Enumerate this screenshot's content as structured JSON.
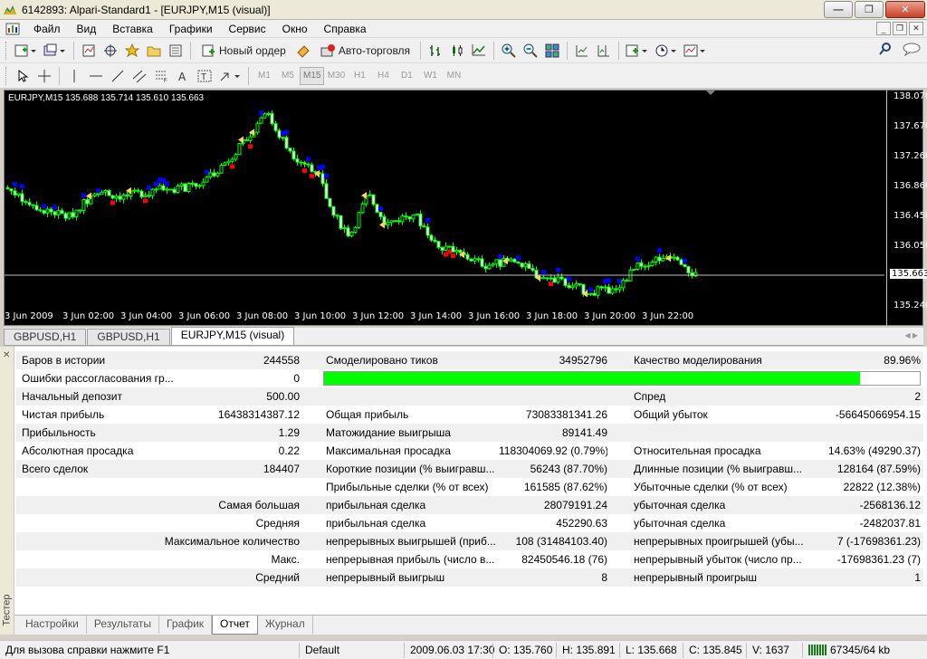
{
  "window": {
    "title": "6142893: Alpari-Standard1 - [EURJPY,M15 (visual)]"
  },
  "menu": {
    "items": [
      "Файл",
      "Вид",
      "Вставка",
      "Графики",
      "Сервис",
      "Окно",
      "Справка"
    ]
  },
  "toolbar": {
    "new_order_label": "Новый ордер",
    "auto_trade_label": "Авто-торговля",
    "timeframes": [
      "M1",
      "M5",
      "M15",
      "M30",
      "H1",
      "H4",
      "D1",
      "W1",
      "MN"
    ],
    "active_timeframe": "M15"
  },
  "chart": {
    "info": "EURJPY,M15  135.688 135.714 135.610 135.663",
    "price_labels": [
      "138.070",
      "137.670",
      "137.260",
      "136.860",
      "136.450",
      "136.050",
      "135.663",
      "135.240"
    ],
    "current_price": "135.663",
    "time_labels": [
      "3 Jun 2009",
      "3 Jun 02:00",
      "3 Jun 04:00",
      "3 Jun 06:00",
      "3 Jun 08:00",
      "3 Jun 10:00",
      "3 Jun 12:00",
      "3 Jun 14:00",
      "3 Jun 16:00",
      "3 Jun 18:00",
      "3 Jun 20:00",
      "3 Jun 22:00"
    ],
    "colors": {
      "background": "#000000",
      "bull": "#00ff00",
      "bear": "#ffffff",
      "buy_marker": "#0000ff",
      "sell_marker": "#ff0000",
      "arrow": "#ffd060"
    }
  },
  "chart_tabs": {
    "items": [
      "GBPUSD,H1",
      "GBPUSD,H1",
      "EURJPY,M15 (visual)"
    ],
    "active": 2
  },
  "report": {
    "r1": {
      "l1": "Баров в истории",
      "v1": "244558",
      "l2": "Смоделировано тиков",
      "v2": "34952796",
      "l3": "Качество моделирования",
      "v3": "89.96%"
    },
    "r2": {
      "l1": "Ошибки рассогласования гр...",
      "v1": "0",
      "progress": 89.96
    },
    "r3": {
      "l1": "Начальный депозит",
      "v1": "500.00",
      "l3": "Спред",
      "v3": "2"
    },
    "r4": {
      "l1": "Чистая прибыль",
      "v1": "16438314387.12",
      "l2": "Общая прибыль",
      "v2": "73083381341.26",
      "l3": "Общий убыток",
      "v3": "-56645066954.15"
    },
    "r5": {
      "l1": "Прибыльность",
      "v1": "1.29",
      "l2": "Матожидание выигрыша",
      "v2": "89141.49"
    },
    "r6": {
      "l1": "Абсолютная просадка",
      "v1": "0.22",
      "l2": "Максимальная просадка",
      "v2": "118304069.92 (0.79%)",
      "l3": "Относительная просадка",
      "v3": "14.63% (49290.37)"
    },
    "r7": {
      "l1": "Всего сделок",
      "v1": "184407",
      "l2": "Короткие позиции (% выигравш...",
      "v2": "56243 (87.70%)",
      "l3": "Длинные позиции (% выигравш...",
      "v3": "128164 (87.59%)"
    },
    "r8": {
      "l2": "Прибыльные сделки (% от всех)",
      "v2": "161585 (87.62%)",
      "l3": "Убыточные сделки (% от всех)",
      "v3": "22822 (12.38%)"
    },
    "r9": {
      "l1": "Самая большая",
      "l2": "прибыльная сделка",
      "v2": "28079191.24",
      "l3": "убыточная сделка",
      "v3": "-2568136.12"
    },
    "r10": {
      "l1": "Средняя",
      "l2": "прибыльная сделка",
      "v2": "452290.63",
      "l3": "убыточная сделка",
      "v3": "-2482037.81"
    },
    "r11": {
      "l1": "Максимальное количество",
      "l2": "непрерывных выигрышей (приб...",
      "v2": "108 (31484103.40)",
      "l3": "непрерывных проигрышей (убы...",
      "v3": "7 (-17698361.23)"
    },
    "r12": {
      "l1": "Макс.",
      "l2": "непрерывная прибыль (число в...",
      "v2": "82450546.18 (76)",
      "l3": "непрерывный убыток (число пр...",
      "v3": "-17698361.23 (7)"
    },
    "r13": {
      "l1": "Средний",
      "l2": "непрерывный выигрыш",
      "v2": "8",
      "l3": "непрерывный проигрыш",
      "v3": "1"
    }
  },
  "side_panel": {
    "title": "Тестер"
  },
  "bottom_tabs": {
    "items": [
      "Настройки",
      "Результаты",
      "График",
      "Отчет",
      "Журнал"
    ],
    "active": 3
  },
  "status": {
    "help": "Для вызова справки нажмите F1",
    "profile": "Default",
    "datetime": "2009.06.03 17:30",
    "open": "O: 135.760",
    "high": "H: 135.891",
    "low": "L: 135.668",
    "close": "C: 135.845",
    "volume": "V: 1637",
    "traffic": "67345/64 kb"
  }
}
